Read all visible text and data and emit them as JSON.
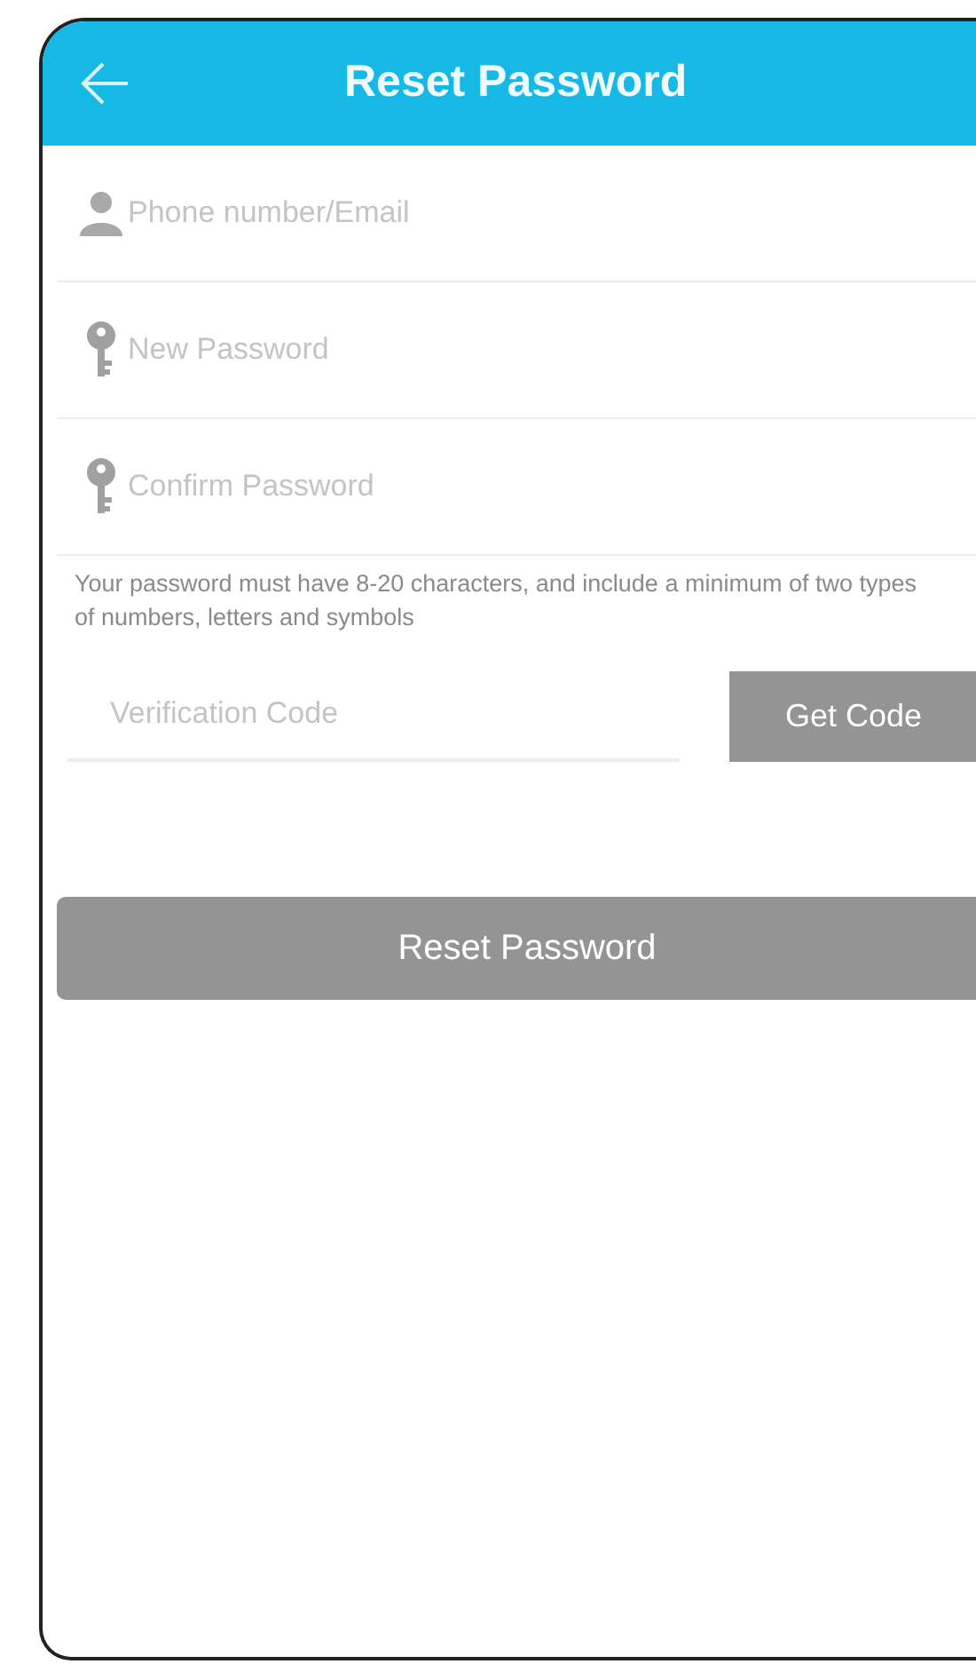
{
  "header": {
    "title": "Reset Password"
  },
  "fields": [
    {
      "kind": "user",
      "placeholder": "Phone number/Email"
    },
    {
      "kind": "key",
      "placeholder": "New Password"
    },
    {
      "kind": "key",
      "placeholder": "Confirm Password"
    }
  ],
  "hint": "Your password must have 8-20 characters, and include a minimum of two types of numbers, letters and symbols",
  "verification": {
    "placeholder": "Verification Code",
    "button": {
      "label": "Get Code",
      "disabled": true
    }
  },
  "submit": {
    "label": "Reset Password",
    "disabled": true
  }
}
